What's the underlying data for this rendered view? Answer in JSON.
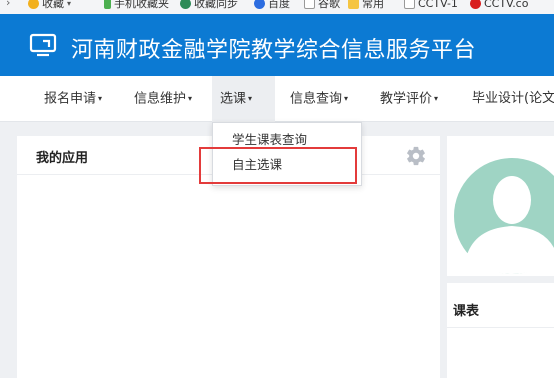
{
  "bookmarks": [
    {
      "label": "",
      "icon": "chevron-right-icon",
      "color": "#666666",
      "caret": false
    },
    {
      "label": "收藏",
      "icon": "star-icon",
      "color": "#f2b01e",
      "caret": true
    },
    {
      "label": "手机收藏夹",
      "icon": "phone-icon",
      "color": "#4caf50",
      "caret": false
    },
    {
      "label": "收藏同步",
      "icon": "sync-icon",
      "color": "#2e8b57",
      "caret": false
    },
    {
      "label": "百度",
      "icon": "baidu-icon",
      "color": "#2d6de0",
      "caret": false
    },
    {
      "label": "谷歌",
      "icon": "page-icon",
      "color": "#999999",
      "caret": false
    },
    {
      "label": "常用",
      "icon": "folder-icon",
      "color": "#f5c542",
      "caret": false
    },
    {
      "label": "CCTV-1",
      "icon": "page-icon",
      "color": "#999999",
      "caret": false
    },
    {
      "label": "CCTV.co",
      "icon": "cctv-icon",
      "color": "#d81e1e",
      "caret": false
    }
  ],
  "header": {
    "title": "河南财政金融学院教学综合信息服务平台",
    "logo_icon": "monitor-icon",
    "bg_color": "#0c7ad3"
  },
  "nav": {
    "items": [
      {
        "label": "报名申请",
        "has_arrow": true
      },
      {
        "label": "信息维护",
        "has_arrow": true
      },
      {
        "label": "选课",
        "has_arrow": true,
        "active": true
      },
      {
        "label": "信息查询",
        "has_arrow": true
      },
      {
        "label": "教学评价",
        "has_arrow": true
      },
      {
        "label": "毕业设计(论文",
        "has_arrow": false
      }
    ],
    "arrow_glyph": "▾"
  },
  "dropdown": {
    "items": [
      {
        "label": "学生课表查询"
      },
      {
        "label": "自主选课",
        "highlighted": true
      }
    ],
    "highlight_color": "#e33b3b"
  },
  "panels": {
    "apps_title": "我的应用",
    "settings_icon": "gear-icon",
    "schedule_title": "课表",
    "avatar_icon": "user-avatar-icon",
    "avatar_color": "#9fd4c4"
  }
}
